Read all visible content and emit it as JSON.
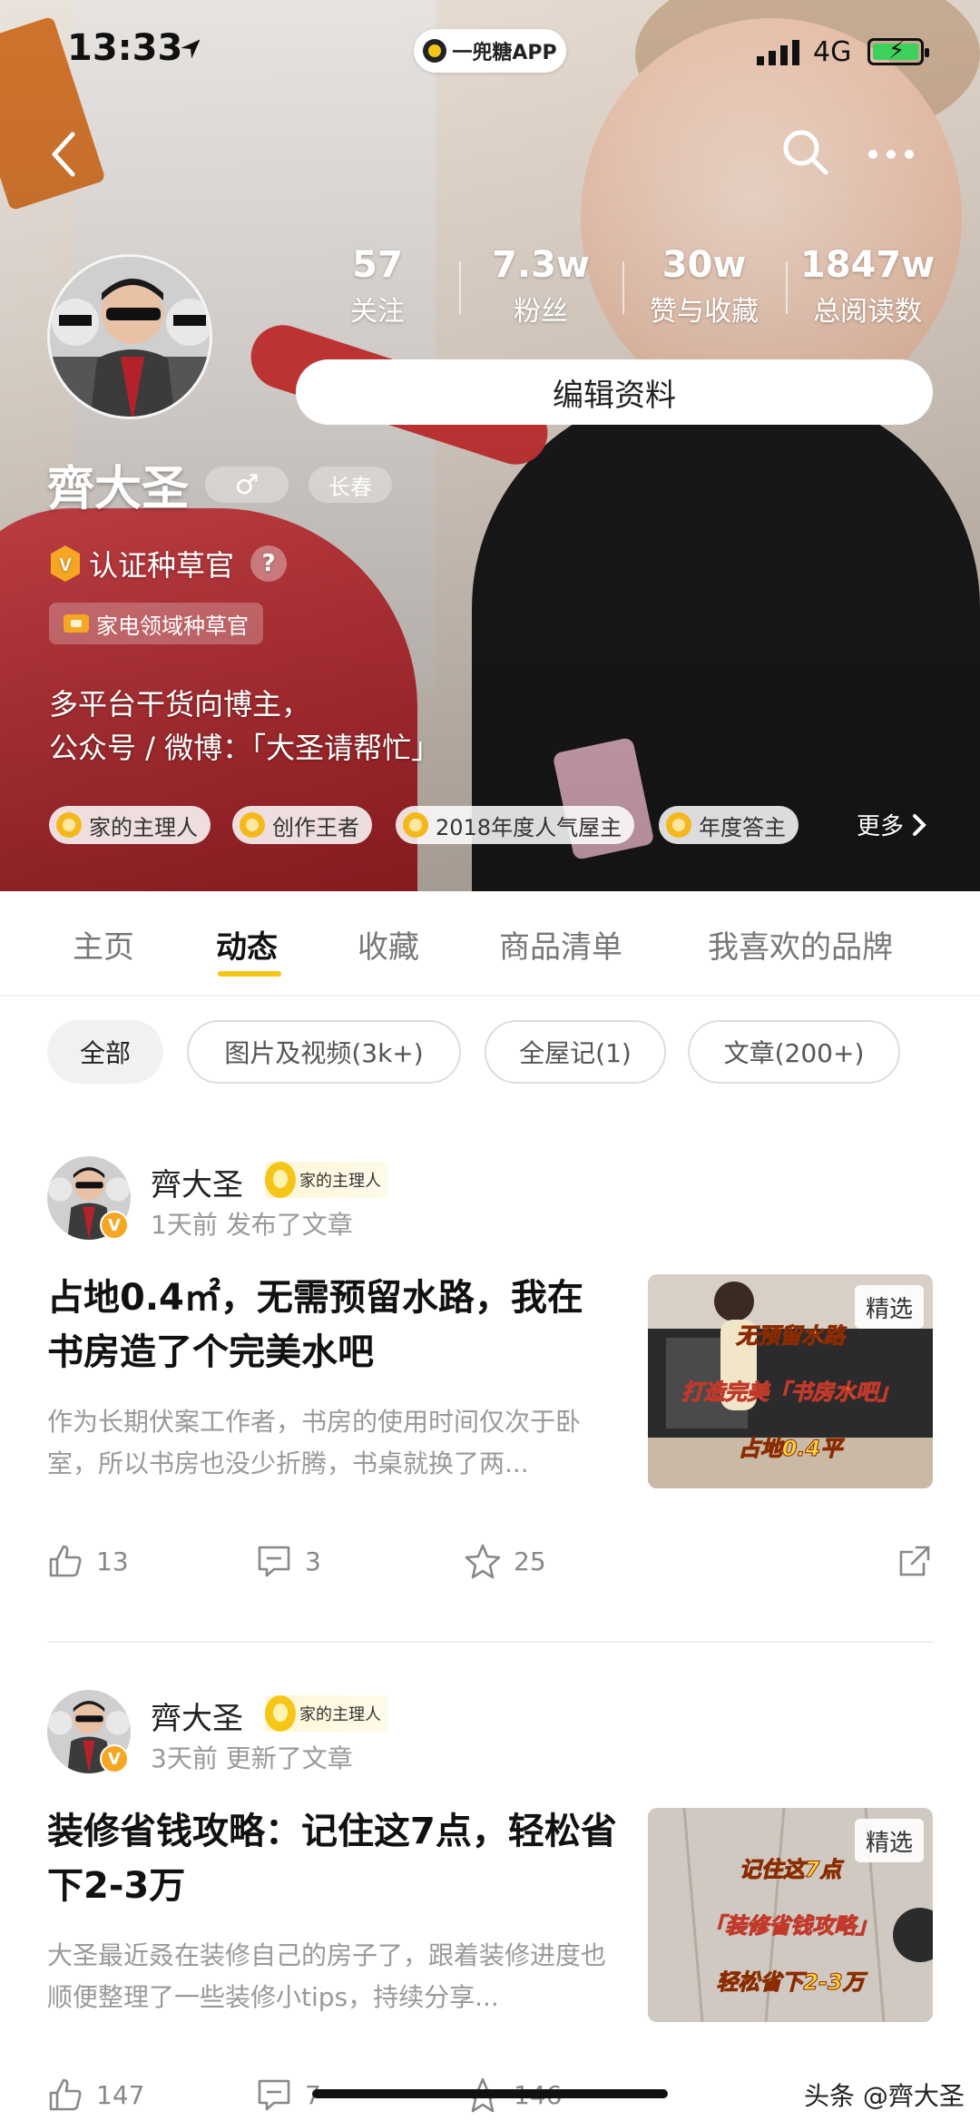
{
  "status_bar": {
    "time": "13:33",
    "app_name": "一兜糖APP",
    "network": "4G"
  },
  "profile": {
    "name": "齊大圣",
    "gender_symbol": "♂",
    "city": "长春",
    "certification": "认证种草官",
    "domain_tag": "家电领域种草官",
    "bio_line1": "多平台干货向博主，",
    "bio_line2": "公众号 /  微博：「大圣请帮忙」",
    "edit_label": "编辑资料",
    "stats": [
      {
        "value": "57",
        "label": "关注"
      },
      {
        "value": "7.3w",
        "label": "粉丝"
      },
      {
        "value": "30w",
        "label": "赞与收藏"
      },
      {
        "value": "1847w",
        "label": "总阅读数"
      }
    ],
    "badges": [
      "家的主理人",
      "创作王者",
      "2018年度人气屋主",
      "年度答主"
    ],
    "more_label": "更多"
  },
  "tabs": [
    "主页",
    "动态",
    "收藏",
    "商品清单",
    "我喜欢的品牌"
  ],
  "filters": [
    "全部",
    "图片及视频(3k+)",
    "全屋记(1)",
    "文章(200+)"
  ],
  "posts": [
    {
      "author": "齊大圣",
      "author_tag": "家的主理人",
      "meta": "1天前 发布了文章",
      "title": "占地0.4㎡，无需预留水路，我在书房造了个完美水吧",
      "excerpt": "作为长期伏案工作者，书房的使用时间仅次于卧室，所以书房也没少折腾，书桌就换了两...",
      "thumb_tag": "精选",
      "thumb_lines": [
        "无预留水路",
        "打造完美「书房水吧」",
        "占地0.4平"
      ],
      "likes": "13",
      "comments": "3",
      "favorites": "25"
    },
    {
      "author": "齊大圣",
      "author_tag": "家的主理人",
      "meta": "3天前 更新了文章",
      "title": "装修省钱攻略：记住这7点，轻松省下2-3万",
      "excerpt": "大圣最近叒在装修自己的房子了，跟着装修进度也顺便整理了一些装修小tips，持续分享...",
      "thumb_tag": "精选",
      "thumb_lines": [
        "记住这7点",
        "「装修省钱攻略」",
        "轻松省下2-3万"
      ],
      "likes": "147",
      "comments": "7",
      "favorites": "146"
    }
  ],
  "watermark": "头条 @齊大圣"
}
